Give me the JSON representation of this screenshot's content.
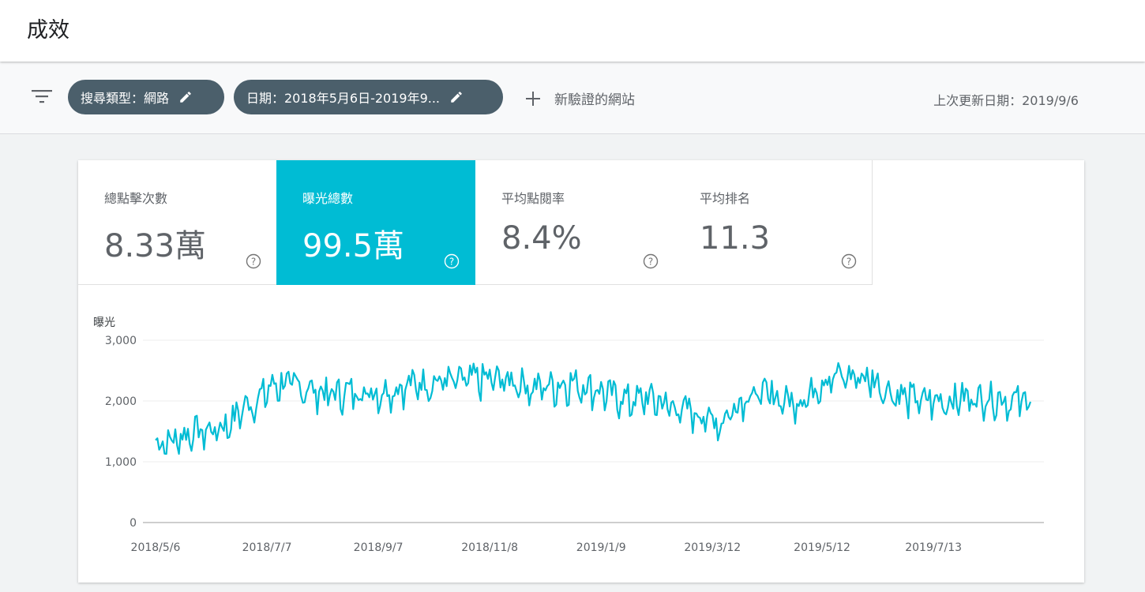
{
  "header": {
    "title": "成效"
  },
  "filters": {
    "filter_icon": "filter-list-icon",
    "search_type_chip": "搜尋類型：網路",
    "date_chip": "日期：2018年5月6日-2019年9...",
    "edit_icon": "pencil-icon",
    "new_label": "新驗證的網站",
    "add_icon": "plus-icon",
    "last_updated": "上次更新日期：2019/9/6"
  },
  "metrics": [
    {
      "label": "總點擊次數",
      "value": "8.33萬",
      "active": false
    },
    {
      "label": "曝光總數",
      "value": "99.5萬",
      "active": true
    },
    {
      "label": "平均點閱率",
      "value": "8.4%",
      "active": false
    },
    {
      "label": "平均排名",
      "value": "11.3",
      "active": false
    }
  ],
  "help_icon": "help-circle-icon",
  "colors": {
    "accent": "#00bcd4",
    "chip_bg": "#4b5f6b",
    "line": "#00bcd4"
  },
  "chart_data": {
    "type": "line",
    "ylabel": "曝光",
    "ylim": [
      0,
      3000
    ],
    "yticks": [
      "0",
      "1,000",
      "2,000",
      "3,000"
    ],
    "ytick_values": [
      0,
      1000,
      2000,
      3000
    ],
    "xticks": [
      "2018/5/6",
      "2018/7/7",
      "2018/9/7",
      "2018/11/8",
      "2019/1/9",
      "2019/3/12",
      "2019/5/12",
      "2019/7/13"
    ],
    "x_start": "2018/5/6",
    "x_end": "2019/9/5",
    "grid": true,
    "series": [
      {
        "weekly_averages": [
          1300,
          1300,
          1400,
          1500,
          1500,
          1550,
          1650,
          1900,
          2000,
          2200,
          2300,
          2250,
          2200,
          2150,
          2100,
          2150,
          2150,
          2150,
          2150,
          2200,
          2250,
          2300,
          2300,
          2350,
          2300,
          2350,
          2350,
          2350,
          2350,
          2300,
          2200,
          2250,
          2250,
          2300,
          2250,
          2200,
          2100,
          2050,
          2000,
          2050,
          2000,
          1900,
          1850,
          1800,
          1700,
          1650,
          1900,
          2100,
          2100,
          2100,
          2000,
          2000,
          2100,
          2350,
          2400,
          2400,
          2400,
          2350,
          2200,
          2100,
          2050,
          2000,
          2000,
          2000,
          2050,
          2050,
          2050,
          2050,
          2000,
          2000,
          2000,
          2000,
          1950,
          1950,
          1950,
          2000,
          2000,
          2050,
          2050,
          2050,
          2050,
          1950,
          1900,
          1900,
          1900,
          1850,
          1850,
          1800,
          1900,
          1950,
          2000,
          2050,
          2000,
          2050,
          2000,
          2000,
          2100,
          2050,
          2000,
          2000
        ],
        "high": 2780,
        "low": 1130
      }
    ]
  }
}
